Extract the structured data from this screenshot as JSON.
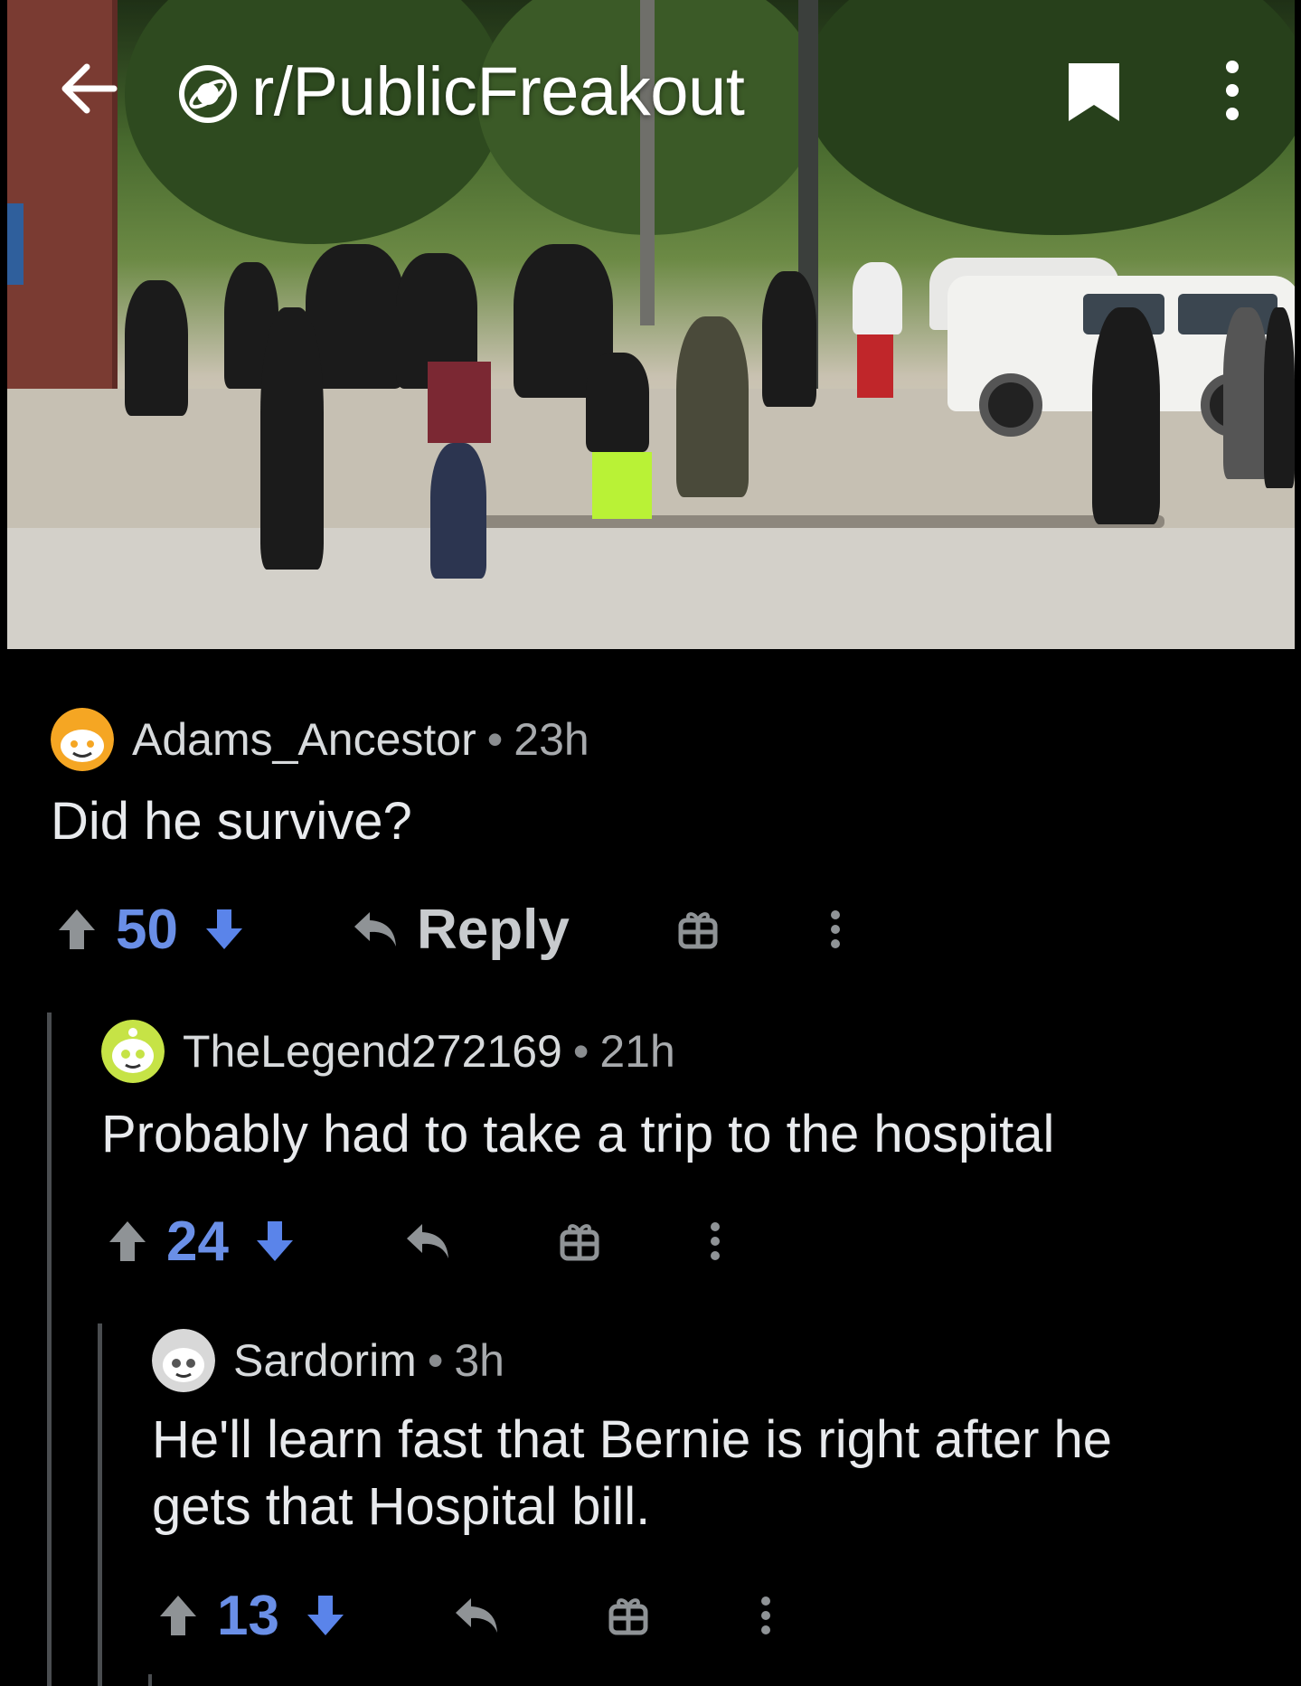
{
  "header": {
    "subreddit": "r/PublicFreakout",
    "icons": [
      "back-arrow-icon",
      "subreddit-planet-icon",
      "bookmark-icon",
      "more-vertical-icon"
    ]
  },
  "colors": {
    "background": "#000000",
    "upvote_score": "#6a8fe7",
    "downvote_arrow": "#5a84ea",
    "thread_line": "#4a4d50",
    "text": "#d7dadc"
  },
  "comments": [
    {
      "username": "Adams_Ancestor",
      "age": "23h",
      "separator": "•",
      "body": "Did he survive?",
      "score": "50",
      "reply_label": "Reply",
      "avatar_color": "#f5a623"
    },
    {
      "username": "TheLegend272169",
      "age": "21h",
      "separator": "•",
      "body": "Probably had to take a trip to the hospital",
      "score": "24",
      "avatar_color": "#c6e346"
    },
    {
      "username": "Sardorim",
      "age": "3h",
      "separator": "•",
      "body_lines": [
        "He'll learn fast that Bernie is right after he",
        "gets that Hospital bill."
      ],
      "score": "13",
      "avatar_color": "#d8d8d8"
    }
  ]
}
